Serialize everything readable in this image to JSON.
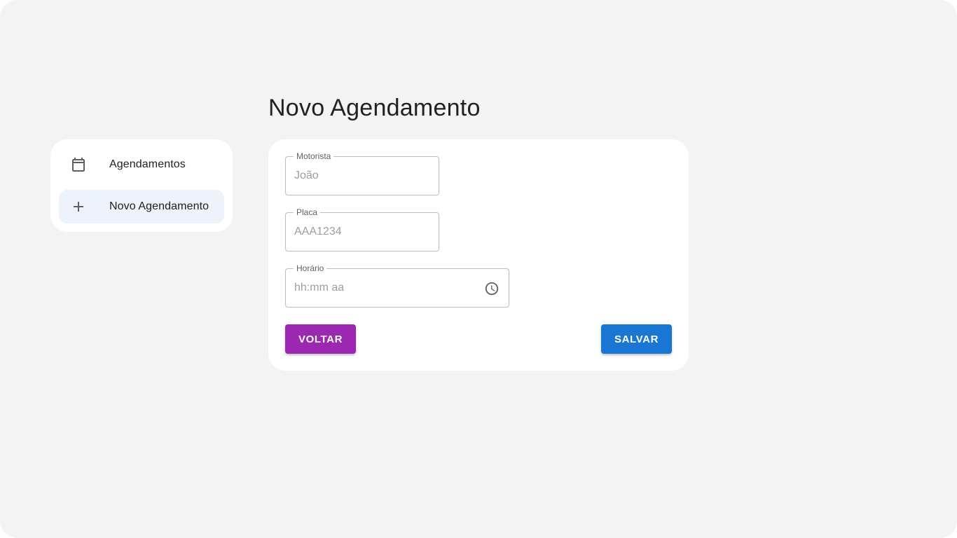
{
  "nav": {
    "items": [
      {
        "label": "Agendamentos",
        "icon": "calendar-icon",
        "active": false
      },
      {
        "label": "Novo Agendamento",
        "icon": "plus-icon",
        "active": true
      }
    ]
  },
  "page": {
    "title": "Novo Agendamento"
  },
  "form": {
    "motorista": {
      "label": "Motorista",
      "placeholder": "João",
      "value": ""
    },
    "placa": {
      "label": "Placa",
      "placeholder": "AAA1234",
      "value": ""
    },
    "horario": {
      "label": "Horário",
      "placeholder": "hh:mm aa",
      "value": "",
      "icon": "clock-icon"
    },
    "back_label": "VOLTAR",
    "save_label": "SALVAR"
  },
  "colors": {
    "background": "#f3f3f3",
    "card": "#ffffff",
    "active_nav": "#edf2fb",
    "back_button": "#9c27b0",
    "save_button": "#1976d2"
  }
}
